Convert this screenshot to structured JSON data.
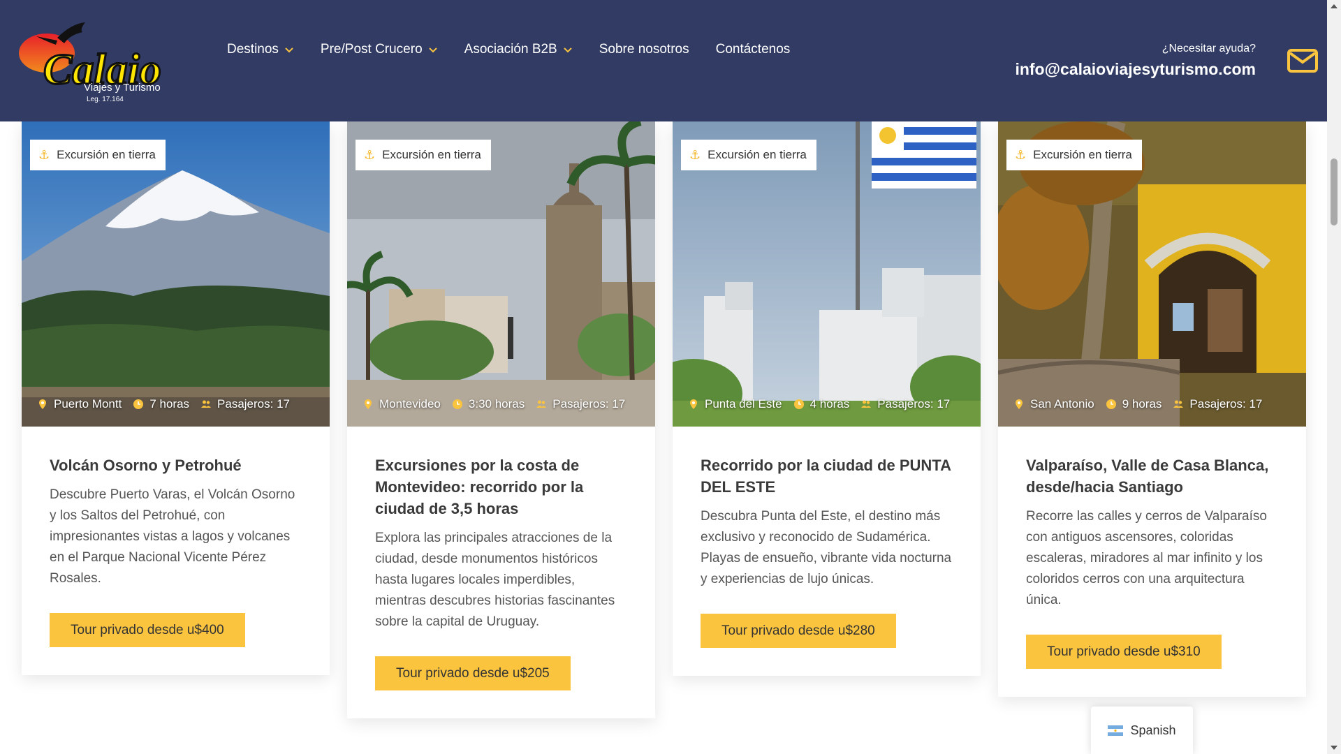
{
  "brand": {
    "name": "Calaio",
    "tagline": "Viajes y Turismo",
    "license": "Leg. 17.164",
    "colors": {
      "header": "#313b64",
      "accent": "#fbc43f",
      "logo_red": "#e8202a",
      "logo_yellow": "#ffe500"
    }
  },
  "nav": {
    "items": [
      {
        "label": "Destinos",
        "dropdown": true
      },
      {
        "label": "Pre/Post Crucero",
        "dropdown": true
      },
      {
        "label": "Asociación B2B",
        "dropdown": true
      },
      {
        "label": "Sobre nosotros",
        "dropdown": false
      },
      {
        "label": "Contáctenos",
        "dropdown": false
      }
    ]
  },
  "help": {
    "label": "¿Necesitar ayuda?",
    "email": "info@calaioviajesyturismo.com",
    "icon": "mail-icon"
  },
  "cards": [
    {
      "tag": "Excursión en tierra",
      "location": "Puerto Montt",
      "duration": "7 horas",
      "passengers": "Pasajeros: 17",
      "title": "Volcán Osorno y Petrohué",
      "description": "Descubre Puerto Varas, el Volcán Osorno y los Saltos del Petrohué, con impresionantes vistas a lagos y volcanes en el Parque Nacional Vicente Pérez Rosales.",
      "cta": "Tour privado desde u$400",
      "image": "volcano-scene"
    },
    {
      "tag": "Excursión en tierra",
      "location": "Montevideo",
      "duration": "3:30 horas",
      "passengers": "Pasajeros: 17",
      "title": "Excursiones por la costa de Montevideo: recorrido por la ciudad de 3,5 horas",
      "description": "Explora las principales atracciones de la ciudad, desde monumentos históricos hasta lugares locales imperdibles, mientras descubres historias fascinantes sobre la capital de Uruguay.",
      "cta": "Tour privado desde u$205",
      "image": "plaza-scene"
    },
    {
      "tag": "Excursión en tierra",
      "location": "Punta del Este",
      "duration": "4 horas",
      "passengers": "Pasajeros: 17",
      "title": "Recorrido por la ciudad de PUNTA DEL ESTE",
      "description": "Descubra Punta del Este, el destino más exclusivo y reconocido de Sudamérica. Playas de ensueño, vibrante vida nocturna y experiencias de lujo únicas.",
      "cta": "Tour privado desde u$280",
      "image": "flag-scene"
    },
    {
      "tag": "Excursión en tierra",
      "location": "San Antonio",
      "duration": "9 horas",
      "passengers": "Pasajeros: 17",
      "title": "Valparaíso, Valle de Casa Blanca, desde/hacia Santiago",
      "description": "Recorre las calles y cerros de Valparaíso con antiguos ascensores, coloridas escaleras, miradores al mar infinito y los coloridos cerros con una arquitectura única.",
      "cta": "Tour privado desde u$310",
      "image": "house-scene"
    }
  ],
  "language": {
    "label": "Spanish",
    "icon": "argentina-flag-icon"
  }
}
